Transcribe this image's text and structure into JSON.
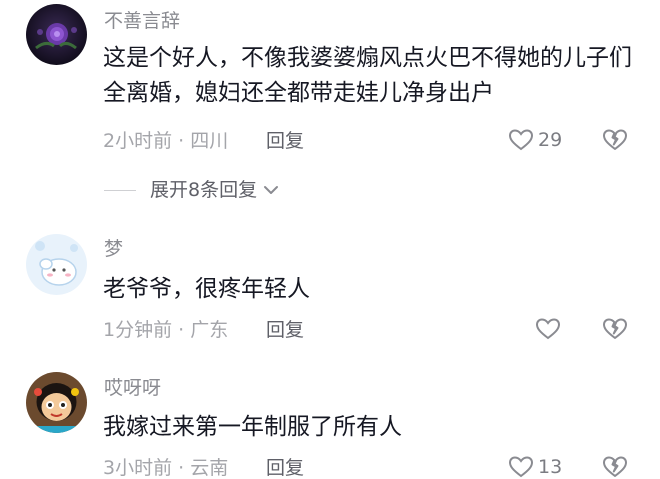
{
  "comments": [
    {
      "username": "不善言辞",
      "text": "这是个好人，不像我婆婆煽风点火巴不得她的儿子们全离婚，媳妇还全都带走娃儿净身出户",
      "meta": "2小时前 · 四川",
      "reply_label": "回复",
      "likes": "29",
      "expand_label": "展开8条回复"
    },
    {
      "username": "梦",
      "text": "老爷爷，很疼年轻人",
      "meta": "1分钟前 · 广东",
      "reply_label": "回复",
      "likes": ""
    },
    {
      "username": "哎呀呀",
      "text": "我嫁过来第一年制服了所有人",
      "meta": "3小时前 · 云南",
      "reply_label": "回复",
      "likes": "13"
    }
  ],
  "colors": {
    "username": "#8a8b91",
    "text": "#161823",
    "meta": "#a4a5aa",
    "reply": "#5f6068"
  }
}
